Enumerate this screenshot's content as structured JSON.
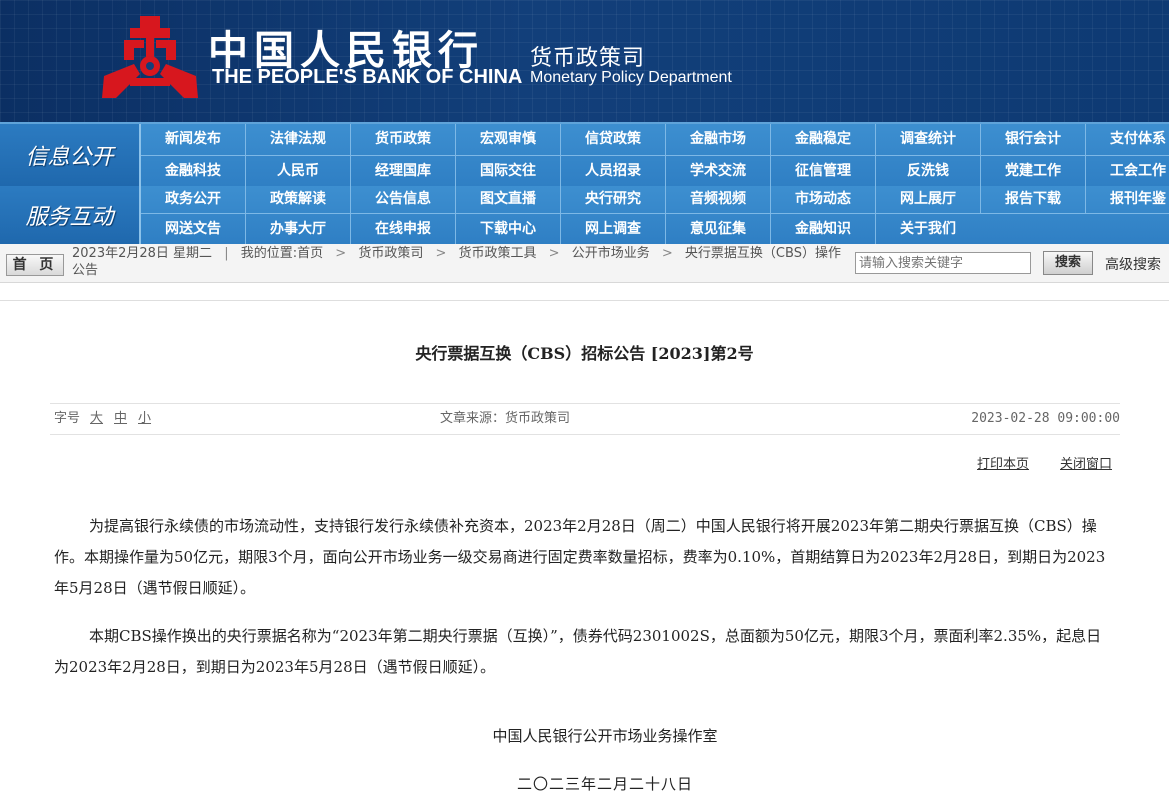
{
  "header": {
    "bank_name_cn": "中国人民银行",
    "bank_name_en": "THE PEOPLE'S BANK OF CHINA",
    "dept_cn": "货币政策司",
    "dept_en": "Monetary Policy Department",
    "logo_icon": "pboc-logo-icon",
    "bg_color": "#0e3a73"
  },
  "nav": {
    "section1_label": "信息公开",
    "section1_row1": [
      "新闻发布",
      "法律法规",
      "货币政策",
      "宏观审慎",
      "信贷政策",
      "金融市场",
      "金融稳定",
      "调查统计",
      "银行会计",
      "支付体系"
    ],
    "section1_row2": [
      "金融科技",
      "人民币",
      "经理国库",
      "国际交往",
      "人员招录",
      "学术交流",
      "征信管理",
      "反洗钱",
      "党建工作",
      "工会工作"
    ],
    "section2_label": "服务互动",
    "section2_row1": [
      "政务公开",
      "政策解读",
      "公告信息",
      "图文直播",
      "央行研究",
      "音频视频",
      "市场动态",
      "网上展厅",
      "报告下载",
      "报刊年鉴"
    ],
    "section2_row2": [
      "网送文告",
      "办事大厅",
      "在线申报",
      "下载中心",
      "网上调查",
      "意见征集",
      "金融知识",
      "关于我们"
    ],
    "accent_color": "#2f7fc4"
  },
  "breadcrumb": {
    "home_button": "首 页",
    "date": "2023年2月28日",
    "weekday": "星期二",
    "location_label": "我的位置:首页",
    "items": [
      "货币政策司",
      "货币政策工具",
      "公开市场业务",
      "央行票据互换（CBS）操作公告"
    ],
    "search_placeholder": "请输入搜索关键字",
    "search_button": "搜索",
    "advanced_search": "高级搜索"
  },
  "article": {
    "title": "央行票据互换（CBS）招标公告 [2023]第2号",
    "font_size_label": "字号",
    "font_large": "大",
    "font_medium": "中",
    "font_small": "小",
    "source": "文章来源：货币政策司",
    "publish_time": "2023-02-28 09:00:00",
    "print_link": "打印本页",
    "close_link": "关闭窗口",
    "paragraph1": "为提高银行永续债的市场流动性，支持银行发行永续债补充资本，2023年2月28日（周二）中国人民银行将开展2023年第二期央行票据互换（CBS）操作。本期操作量为50亿元，期限3个月，面向公开市场业务一级交易商进行固定费率数量招标，费率为0.10%，首期结算日为2023年2月28日，到期日为2023年5月28日（遇节假日顺延）。",
    "paragraph2": "本期CBS操作换出的央行票据名称为“2023年第二期央行票据（互换）”，债券代码2301002S，总面额为50亿元，期限3个月，票面利率2.35%，起息日为2023年2月28日，到期日为2023年5月28日（遇节假日顺延）。",
    "signature": "中国人民银行公开市场业务操作室",
    "sign_date": "二〇二三年二月二十八日"
  }
}
